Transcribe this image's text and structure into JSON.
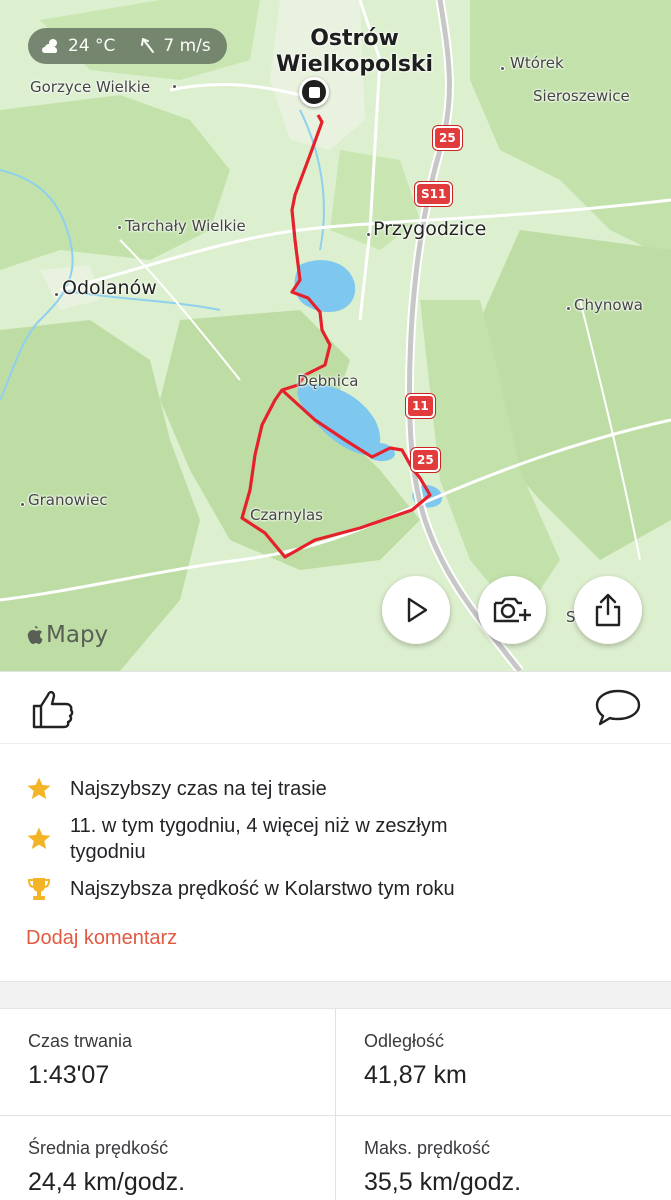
{
  "map": {
    "weather": {
      "temperature": "24 °C",
      "wind": "7 m/s"
    },
    "places": {
      "ostrow": "Ostrów\nWielkopolski",
      "gorzyce": "Gorzyce Wielkie",
      "wtorek": "Wtórek",
      "sieroszewice": "Sieroszewice",
      "tarchaly": "Tarchały Wielkie",
      "przygodzice": "Przygodzice",
      "odolanow": "Odolanów",
      "chynowa": "Chynowa",
      "debnica": "Dębnica",
      "granowiec": "Granowiec",
      "czarnylas": "Czarnylas",
      "cut_label": "S"
    },
    "roads": {
      "r25a": "25",
      "s11": "S11",
      "r11": "11",
      "r25b": "25"
    },
    "attribution": "Mapy",
    "colors": {
      "route": "#e5222b",
      "forest": "#bfdfa7",
      "field": "#dcefce",
      "water": "#7ec7ee"
    }
  },
  "actions": {
    "like_icon": "thumbs-up-icon",
    "comment_icon": "speech-bubble-icon"
  },
  "achievements": [
    {
      "icon": "star-icon",
      "text": "Najszybszy czas na tej trasie"
    },
    {
      "icon": "star-icon",
      "text": "11. w tym tygodniu, 4 więcej niż w zeszłym tygodniu"
    },
    {
      "icon": "trophy-icon",
      "text": "Najszybsza prędkość w Kolarstwo tym roku"
    }
  ],
  "add_comment": "Dodaj komentarz",
  "stats": [
    {
      "label": "Czas trwania",
      "value": "1:43'07"
    },
    {
      "label": "Odległość",
      "value": "41,87 km"
    },
    {
      "label": "Średnia prędkość",
      "value": "24,4 km/godz."
    },
    {
      "label": "Maks. prędkość",
      "value": "35,5 km/godz."
    }
  ]
}
